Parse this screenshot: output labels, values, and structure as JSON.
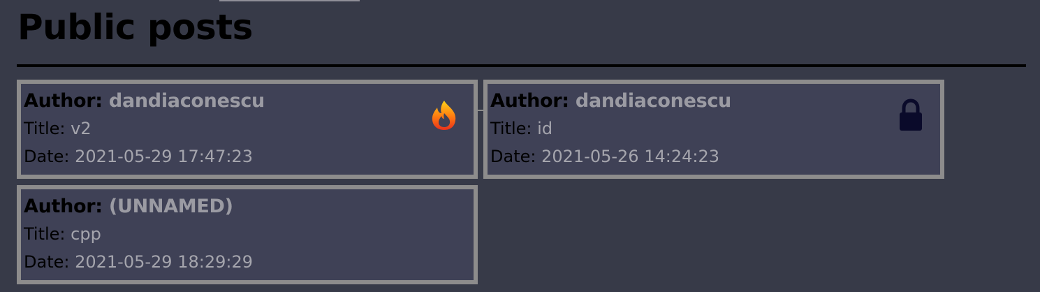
{
  "page": {
    "title": "Public posts"
  },
  "labels": {
    "author": "Author:",
    "title": "Title:",
    "date": "Date:"
  },
  "posts": [
    {
      "author": "dandiaconescu",
      "title": "v2",
      "date": "2021-05-29 17:47:23",
      "icon": "fire-icon"
    },
    {
      "author": "dandiaconescu",
      "title": "id",
      "date": "2021-05-26 14:24:23",
      "icon": "lock-icon"
    },
    {
      "author": "(UNNAMED)",
      "title": "cpp",
      "date": "2021-05-29 18:29:29",
      "icon": ""
    }
  ],
  "colors": {
    "background": "#373a48",
    "card_background": "#3f4156",
    "card_border": "#8d8c8c",
    "value_text": "#a5a5ad",
    "lock": "#0a0a2a"
  }
}
